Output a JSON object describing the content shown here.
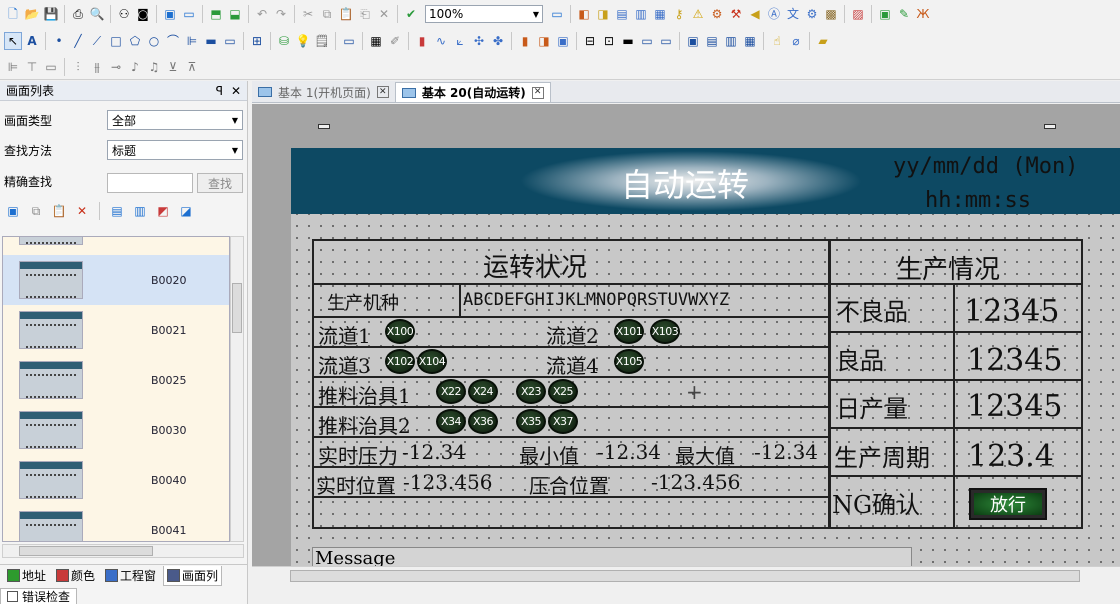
{
  "toolbar": {
    "zoom": "100%",
    "row1_icons": [
      "new-icon",
      "open-icon",
      "save-icon",
      "print-icon",
      "print-preview-icon",
      "binoculars-icon",
      "camera-icon",
      "new-screen-icon",
      "window-icon",
      "import-icon",
      "export-icon",
      "undo-icon",
      "redo-icon",
      "cut-icon",
      "copy-icon",
      "paste-icon",
      "clipboard-icon",
      "delete-icon",
      "check-icon"
    ],
    "row1_right_icons": [
      "image-icon",
      "tag-icon",
      "device-icon",
      "chart-icon",
      "calendar-icon",
      "key-icon",
      "warning-icon",
      "gear-icon",
      "tools-icon",
      "speaker-icon",
      "text-icon",
      "translate-icon",
      "settings-icon",
      "package-icon",
      "color-icon",
      "screen-icon",
      "edit-icon",
      "lang-icon"
    ],
    "row2_icons": [
      "pointer-icon",
      "text-tool-icon",
      "dot-icon",
      "line-icon",
      "polyline-icon",
      "rectangle-icon",
      "polygon-icon",
      "ellipse-icon",
      "arc-icon",
      "scale-icon",
      "lamp-icon",
      "switch-icon",
      "table-icon",
      "disk-icon",
      "bulb-icon",
      "note-icon",
      "frame-icon",
      "grid-icon",
      "brush-icon",
      "bar-chart-icon",
      "line-chart-icon",
      "xy-chart-icon",
      "axis-icon",
      "cross-icon",
      "alarm-icon",
      "history-icon",
      "picture-icon",
      "align-icon",
      "layout-icon",
      "monitor-icon",
      "display-icon",
      "panel-icon",
      "console-icon",
      "list-icon",
      "ruler-icon",
      "pin-icon",
      "level-icon",
      "ink-icon"
    ],
    "row3_icons": [
      "align-left-icon",
      "align-top-icon",
      "align-center-icon",
      "distribute-h-icon",
      "distribute-v-icon",
      "rotate-icon",
      "flip-h-icon",
      "flip-v-icon",
      "group-icon",
      "ungroup-icon"
    ]
  },
  "left_panel": {
    "title": "画面列表",
    "pin_label": "ꟼ",
    "close_label": "✕",
    "filters": {
      "type_label": "画面类型",
      "type_value": "全部",
      "method_label": "查找方法",
      "method_value": "标题",
      "exact_label": "精确查找",
      "exact_value": "",
      "find_button": "查找"
    },
    "list_items": [
      {
        "code": ""
      },
      {
        "code": "B0020"
      },
      {
        "code": "B0021"
      },
      {
        "code": "B0025"
      },
      {
        "code": "B0030"
      },
      {
        "code": "B0040"
      },
      {
        "code": "B0041"
      }
    ],
    "bottom_tabs": [
      {
        "label": "地址",
        "color": "#2e9b2e"
      },
      {
        "label": "颜色",
        "color": "#c83a3a"
      },
      {
        "label": "工程窗",
        "color": "#3a6ec8"
      },
      {
        "label": "画面列",
        "color": "#4a5a8a"
      }
    ],
    "error_tab": "错误检查"
  },
  "doc_tabs": [
    {
      "label": "基本 1(开机页面)",
      "active": false
    },
    {
      "label": "基本 20(自动运转)",
      "active": true
    }
  ],
  "screen": {
    "title": "自动运转",
    "date_format": "yy/mm/dd (Mon)",
    "time_format": "hh:mm:ss",
    "status_section": "运转状况",
    "production_section": "生产情况",
    "model_label": "生产机种",
    "model_value": "ABCDEFGHIJKLMNOPQRSTUVWXYZ",
    "lane1": "流道1",
    "lane2": "流道2",
    "lane3": "流道3",
    "lane4": "流道4",
    "fixture1": "推料治具1",
    "fixture2": "推料治具2",
    "lamps": {
      "x100": "X100",
      "x101": "X101",
      "x103": "X103",
      "x102": "X102",
      "x104": "X104",
      "x105": "X105",
      "x22": "X22",
      "x24": "X24",
      "x23": "X23",
      "x25": "X25",
      "x34": "X34",
      "x36": "X36",
      "x35": "X35",
      "x37": "X37"
    },
    "pressure_label": "实时压力",
    "pressure_value": "-12.34",
    "min_label": "最小值",
    "min_value": "-12.34",
    "max_label": "最大值",
    "max_value": "-12.34",
    "position_label": "实时位置",
    "position_value": "-123.456",
    "press_pos_label": "压合位置",
    "press_pos_value": "-123.456",
    "defect_label": "不良品",
    "defect_value": "12345",
    "good_label": "良品",
    "good_value": "12345",
    "daily_label": "日产量",
    "daily_value": "12345",
    "cycle_label": "生产周期",
    "cycle_value": "123.4",
    "ng_label": "NG确认",
    "release_button": "放行",
    "message": "Message"
  }
}
